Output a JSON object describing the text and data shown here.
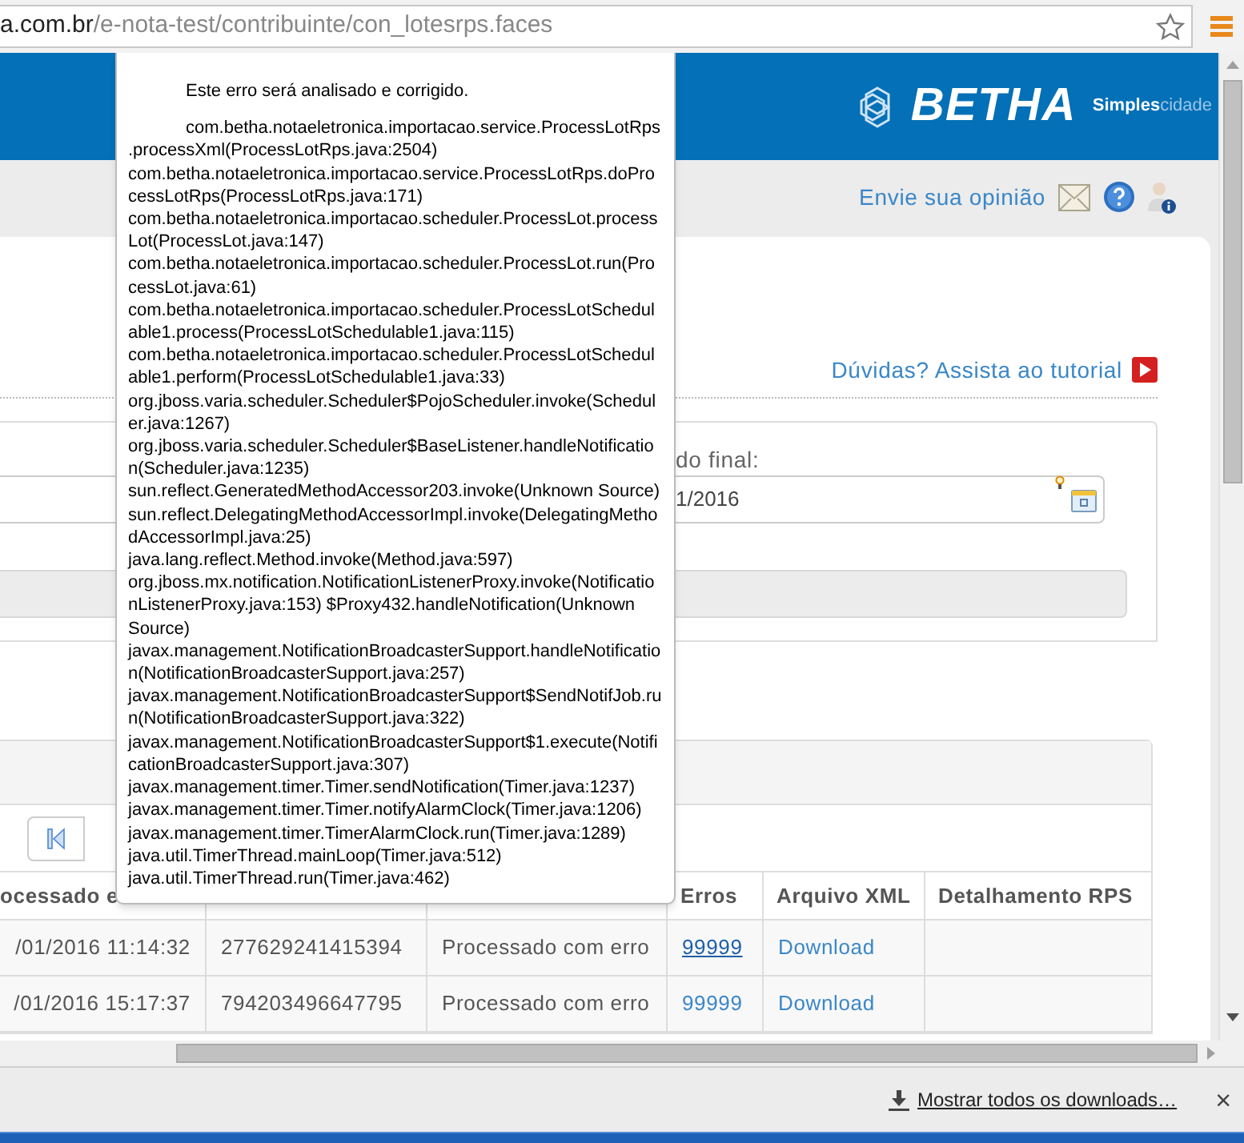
{
  "browser": {
    "url_host": "a.com.br",
    "url_path": "/e-nota-test/contribuinte/con_lotesrps.faces"
  },
  "header": {
    "brand": "BETHA",
    "tagline_bold": "Simples",
    "tagline_light": "cidade"
  },
  "toolbar": {
    "feedback_link": "Envie sua opinião"
  },
  "tutorial_link": "Dúvidas? Assista ao tutorial",
  "filter": {
    "end_label": "do final:",
    "end_value": "1/2016"
  },
  "table": {
    "columns": {
      "column_1": "ocessado e",
      "erros": "Erros",
      "arquivo_xml": "Arquivo XML",
      "detalhamento_rps": "Detalhamento RPS"
    },
    "rows": [
      {
        "column_1": "/01/2016 11:14:32",
        "column_2": "277629241415394",
        "column_3": "Processado com erro",
        "erros": "99999",
        "erros_hovered": true,
        "arquivo_xml": "Download"
      },
      {
        "column_1": "/01/2016 15:17:37",
        "column_2": "794203496647795",
        "column_3": "Processado com erro",
        "erros": "99999",
        "erros_hovered": false,
        "arquivo_xml": "Download"
      }
    ]
  },
  "error_popup": {
    "paragraphs": [
      "Este erro será analisado e corrigido.",
      "com.betha.notaeletronica.importacao.service.ProcessLotRps.processXml(ProcessLotRps.java:2504) com.betha.notaeletronica.importacao.service.ProcessLotRps.doProcessLotRps(ProcessLotRps.java:171) com.betha.notaeletronica.importacao.scheduler.ProcessLot.processLot(ProcessLot.java:147) com.betha.notaeletronica.importacao.scheduler.ProcessLot.run(ProcessLot.java:61) com.betha.notaeletronica.importacao.scheduler.ProcessLotSchedulable1.process(ProcessLotSchedulable1.java:115) com.betha.notaeletronica.importacao.scheduler.ProcessLotSchedulable1.perform(ProcessLotSchedulable1.java:33) org.jboss.varia.scheduler.Scheduler$PojoScheduler.invoke(Scheduler.java:1267) org.jboss.varia.scheduler.Scheduler$BaseListener.handleNotification(Scheduler.java:1235) sun.reflect.GeneratedMethodAccessor203.invoke(Unknown Source) sun.reflect.DelegatingMethodAccessorImpl.invoke(DelegatingMethodAccessorImpl.java:25) java.lang.reflect.Method.invoke(Method.java:597) org.jboss.mx.notification.NotificationListenerProxy.invoke(NotificationListenerProxy.java:153) $Proxy432.handleNotification(Unknown Source) javax.management.NotificationBroadcasterSupport.handleNotification(NotificationBroadcasterSupport.java:257) javax.management.NotificationBroadcasterSupport$SendNotifJob.run(NotificationBroadcasterSupport.java:322) javax.management.NotificationBroadcasterSupport$1.execute(NotificationBroadcasterSupport.java:307) javax.management.timer.Timer.sendNotification(Timer.java:1237) javax.management.timer.Timer.notifyAlarmClock(Timer.java:1206) javax.management.timer.TimerAlarmClock.run(Timer.java:1289) java.util.TimerThread.mainLoop(Timer.java:512) java.util.TimerThread.run(Timer.java:462)"
    ]
  },
  "downloads_bar": {
    "link": "Mostrar todos os downloads…",
    "close": "×"
  }
}
